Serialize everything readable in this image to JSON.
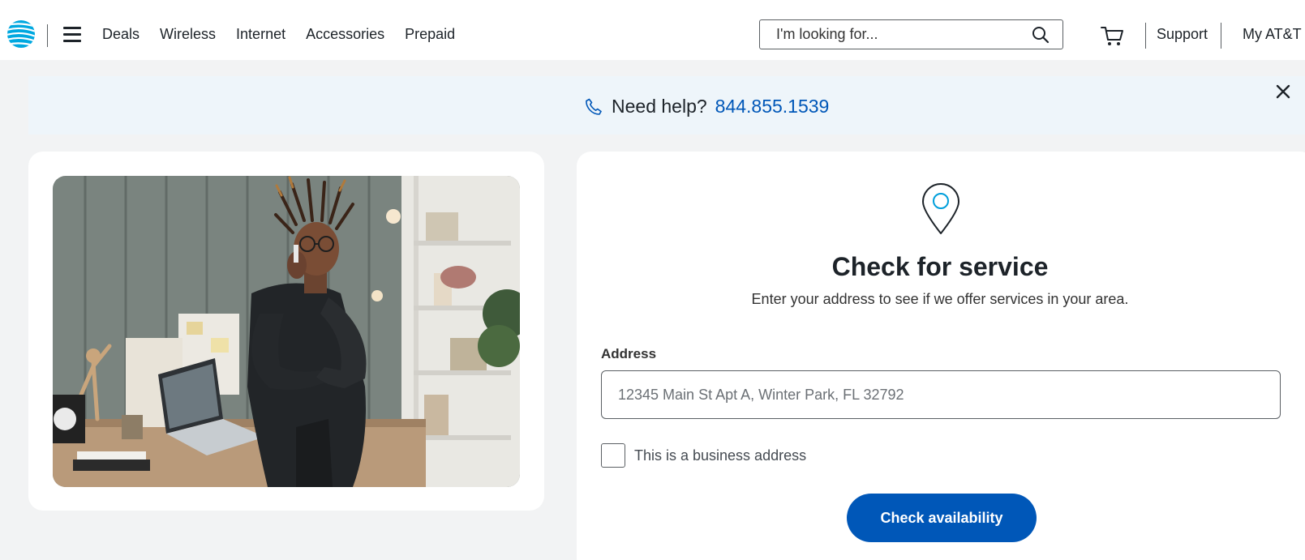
{
  "header": {
    "logo_name": "AT&T globe logo",
    "nav": [
      "Deals",
      "Wireless",
      "Internet",
      "Accessories",
      "Prepaid"
    ],
    "search": {
      "placeholder": "I'm looking for..."
    },
    "support_label": "Support",
    "myatt_label": "My AT&T"
  },
  "banner": {
    "text": "Need help?",
    "phone": "844.855.1539"
  },
  "service": {
    "title": "Check for service",
    "subtitle": "Enter your address to see if we offer services in your area.",
    "address_label": "Address",
    "address_placeholder": "12345 Main St Apt A, Winter Park, FL 32792",
    "business_label": "This is a business address",
    "button_label": "Check availability"
  },
  "colors": {
    "brand_blue": "#0057b8",
    "banner_bg": "#eef5fa",
    "page_bg": "#f2f3f4",
    "logo_cyan": "#00a8e0"
  }
}
